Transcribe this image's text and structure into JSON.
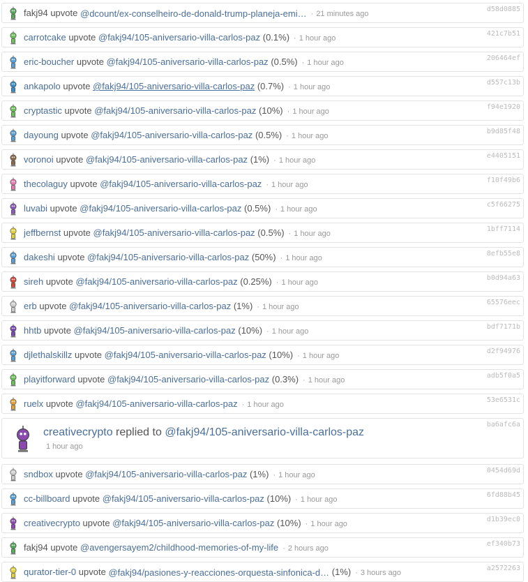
{
  "feed": {
    "items": [
      {
        "user": "fakj94",
        "user_dark": true,
        "verb": "upvote",
        "link": "@dcount/ex-conselheiro-de-donald-trump-planeja-emi…",
        "pct": "",
        "time": "21 minutes ago",
        "hash": "d58d0885",
        "avatar_color": "#5aa860"
      },
      {
        "user": "carrotcake",
        "verb": "upvote",
        "link": "@fakj94/105-aniversario-villa-carlos-paz",
        "pct": "(0.1%)",
        "time": "1 hour ago",
        "hash": "421c7b51",
        "avatar_color": "#6cbf5a"
      },
      {
        "user": "eric-boucher",
        "verb": "upvote",
        "link": "@fakj94/105-aniversario-villa-carlos-paz",
        "pct": "(0.5%)",
        "time": "1 hour ago",
        "hash": "206464ef",
        "avatar_color": "#5a9fd4"
      },
      {
        "user": "ankapolo",
        "verb": "upvote",
        "link": "@fakj94/105-aniversario-villa-carlos-paz",
        "link_underline": true,
        "pct": "(0.7%)",
        "time": "1 hour ago",
        "hash": "d557c13b",
        "avatar_color": "#3a8cc8"
      },
      {
        "user": "cryptastic",
        "verb": "upvote",
        "link": "@fakj94/105-aniversario-villa-carlos-paz",
        "pct": "(10%)",
        "time": "1 hour ago",
        "hash": "f94e1920",
        "avatar_color": "#6cbf5a"
      },
      {
        "user": "dayoung",
        "verb": "upvote",
        "link": "@fakj94/105-aniversario-villa-carlos-paz",
        "pct": "(0.5%)",
        "time": "1 hour ago",
        "hash": "b9d85f48",
        "avatar_color": "#5a9fd4"
      },
      {
        "user": "voronoi",
        "verb": "upvote",
        "link": "@fakj94/105-aniversario-villa-carlos-paz",
        "pct": "(1%)",
        "time": "1 hour ago",
        "hash": "e4405151",
        "avatar_color": "#8a6a4a"
      },
      {
        "user": "thecolaguy",
        "verb": "upvote",
        "link": "@fakj94/105-aniversario-villa-carlos-paz",
        "pct": "",
        "time": "1 hour ago",
        "hash": "f10f49b6",
        "avatar_color": "#e07ab0"
      },
      {
        "user": "luvabi",
        "verb": "upvote",
        "link": "@fakj94/105-aniversario-villa-carlos-paz",
        "pct": "(0.5%)",
        "time": "1 hour ago",
        "hash": "c5f66275",
        "avatar_color": "#8a5ab4"
      },
      {
        "user": "jeffbernst",
        "verb": "upvote",
        "link": "@fakj94/105-aniversario-villa-carlos-paz",
        "pct": "(0.5%)",
        "time": "1 hour ago",
        "hash": "1bff7114",
        "avatar_color": "#e0d040"
      },
      {
        "user": "dakeshi",
        "verb": "upvote",
        "link": "@fakj94/105-aniversario-villa-carlos-paz",
        "pct": "(50%)",
        "time": "1 hour ago",
        "hash": "8efb55e8",
        "avatar_color": "#5a9fd4"
      },
      {
        "user": "sireh",
        "verb": "upvote",
        "link": "@fakj94/105-aniversario-villa-carlos-paz",
        "pct": "(0.25%)",
        "time": "1 hour ago",
        "hash": "b0d94a63",
        "avatar_color": "#d04a3a"
      },
      {
        "user": "erb",
        "verb": "upvote",
        "link": "@fakj94/105-aniversario-villa-carlos-paz",
        "pct": "(1%)",
        "time": "1 hour ago",
        "hash": "65576eec",
        "avatar_color": "#cccccc"
      },
      {
        "user": "hhtb",
        "verb": "upvote",
        "link": "@fakj94/105-aniversario-villa-carlos-paz",
        "pct": "(10%)",
        "time": "1 hour ago",
        "hash": "bdf7171b",
        "avatar_color": "#7a4ab0"
      },
      {
        "user": "djlethalskillz",
        "verb": "upvote",
        "link": "@fakj94/105-aniversario-villa-carlos-paz",
        "pct": "(10%)",
        "time": "1 hour ago",
        "hash": "d2f94976",
        "avatar_color": "#5a9fd4"
      },
      {
        "user": "playitforward",
        "verb": "upvote",
        "link": "@fakj94/105-aniversario-villa-carlos-paz",
        "pct": "(0.3%)",
        "time": "1 hour ago",
        "hash": "adb5f0a5",
        "avatar_color": "#6cbf5a"
      },
      {
        "user": "ruelx",
        "verb": "upvote",
        "link": "@fakj94/105-aniversario-villa-carlos-paz",
        "pct": "",
        "time": "1 hour ago",
        "hash": "53e6531c",
        "avatar_color": "#e0a040"
      },
      {
        "big": true,
        "user": "creativecrypto",
        "verb": "replied to",
        "link": "@fakj94/105-aniversario-villa-carlos-paz",
        "time": "1 hour ago",
        "hash": "ba6afc6a",
        "avatar_color": "#8a4ab0"
      },
      {
        "user": "sndbox",
        "verb": "upvote",
        "link": "@fakj94/105-aniversario-villa-carlos-paz",
        "pct": "(1%)",
        "time": "1 hour ago",
        "hash": "0454d69d",
        "avatar_color": "#cccccc"
      },
      {
        "user": "cc-billboard",
        "verb": "upvote",
        "link": "@fakj94/105-aniversario-villa-carlos-paz",
        "pct": "(10%)",
        "time": "1 hour ago",
        "hash": "6fd88b45",
        "avatar_color": "#5a9fd4"
      },
      {
        "user": "creativecrypto",
        "verb": "upvote",
        "link": "@fakj94/105-aniversario-villa-carlos-paz",
        "pct": "(10%)",
        "time": "1 hour ago",
        "hash": "d1b39ec0",
        "avatar_color": "#8a4ab0"
      },
      {
        "user": "fakj94",
        "user_dark": true,
        "verb": "upvote",
        "link": "@avengersayem2/childhood-memories-of-my-life",
        "pct": "",
        "time": "2 hours ago",
        "hash": "ef340b73",
        "avatar_color": "#5aa860"
      },
      {
        "user": "qurator-tier-0",
        "verb": "upvote",
        "link": "@fakj94/pasiones-y-reacciones-orquesta-sinfonica-d…",
        "pct": "(1%)",
        "time": "3 hours ago",
        "hash": "a2572263",
        "avatar_color": "#e0d040"
      }
    ]
  }
}
